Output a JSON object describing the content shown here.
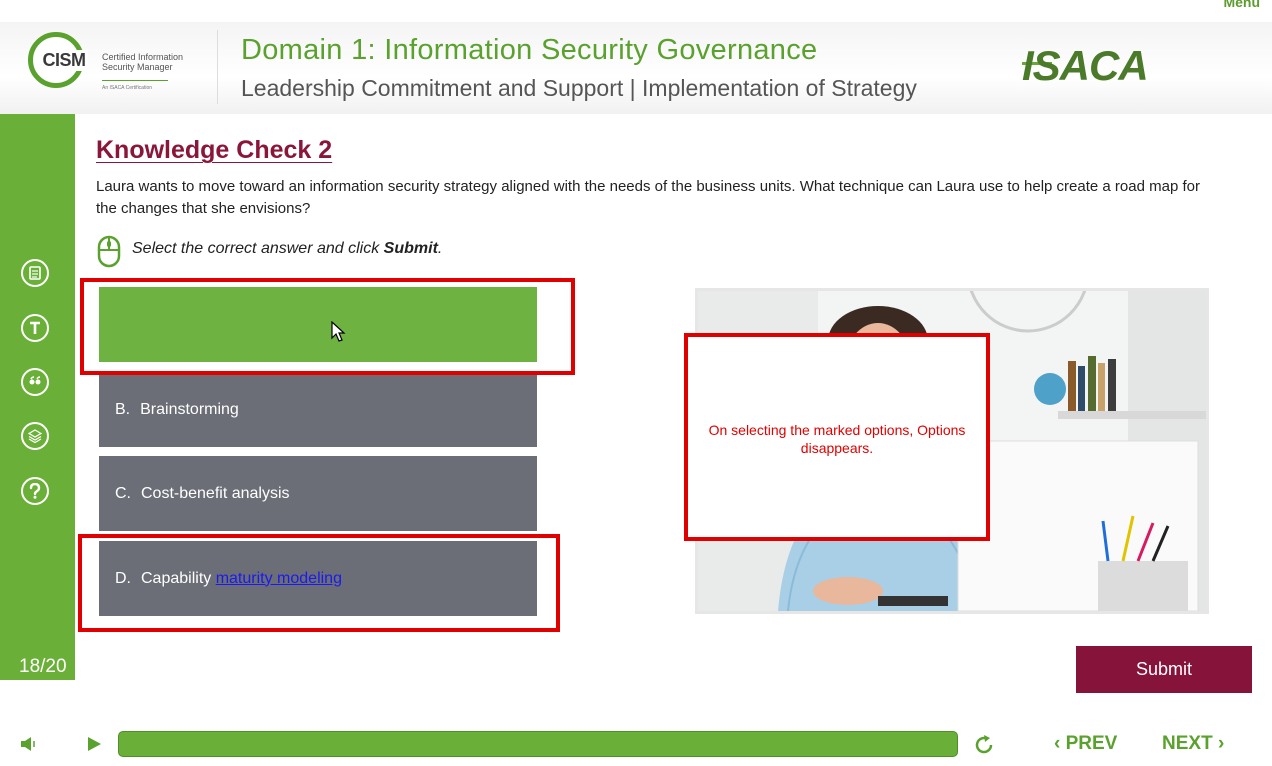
{
  "top_link": "Menu",
  "header": {
    "logo_abbrev": "CISM",
    "logo_line1": "Certified Information",
    "logo_line2": "Security Manager",
    "logo_tagline": "An ISACA Certification",
    "title": "Domain 1: Information Security Governance",
    "subtitle": "Leadership Commitment and Support | Implementation of Strategy",
    "brand": "ISACA"
  },
  "sidebar": {
    "icons": [
      "glossary-icon",
      "transcript-icon",
      "quote-icon",
      "layers-icon",
      "help-icon"
    ],
    "page_counter": "18/20"
  },
  "content": {
    "heading": "Knowledge Check 2",
    "question": "Laura wants to move toward an information security strategy aligned with the needs of the business units. What technique can Laura use to help create a road map for the changes that she envisions?",
    "instruction_prefix": "Select the correct answer and click ",
    "instruction_action": "Submit",
    "instruction_suffix": ".",
    "options": [
      {
        "letter": "",
        "text": ""
      },
      {
        "letter": "B.",
        "text": "Brainstorming"
      },
      {
        "letter": "C.",
        "text": "Cost-benefit analysis"
      },
      {
        "letter": "D.",
        "text": "Capability ",
        "link_text": "maturity modeling"
      }
    ],
    "annotation": "On selecting the marked options, Options disappears.",
    "submit_label": "Submit"
  },
  "footer": {
    "prev_label": "PREV",
    "next_label": "NEXT",
    "progress": 1.0
  },
  "colors": {
    "brand_green": "#6aaf37",
    "maroon": "#861339",
    "option_gray": "#6b6e76",
    "highlight_red": "#e10000"
  }
}
